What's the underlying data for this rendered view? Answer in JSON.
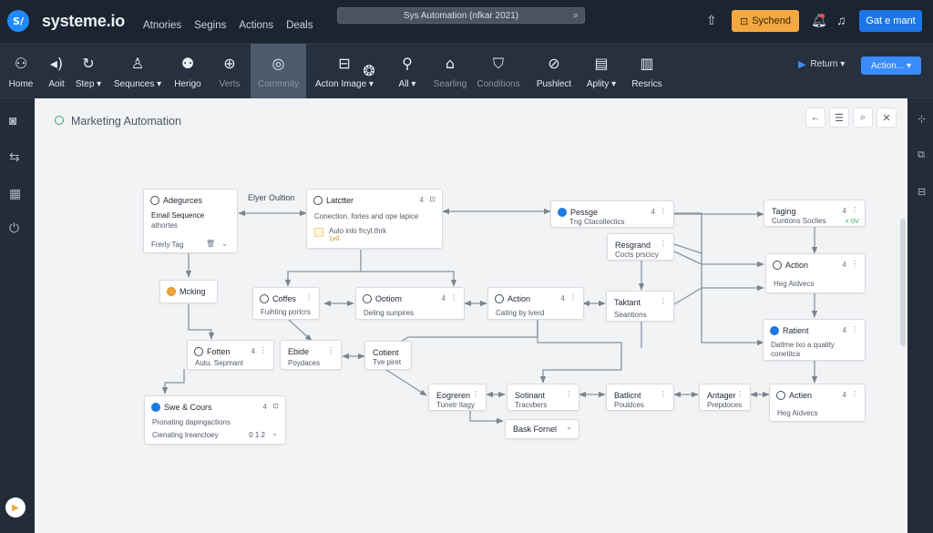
{
  "app": {
    "logo_badge": "S/",
    "logo_text": "systeme.io",
    "nav": [
      "Atnories",
      "Segins",
      "Actions",
      "Deals"
    ],
    "search_text": "Sys Automation (nfkar 2021)",
    "btn_orange": "Sychend",
    "btn_blue": "Gat e mant"
  },
  "toolbar": {
    "items": [
      {
        "label": "Home",
        "icon": "dashboard-icon"
      },
      {
        "label": "Aoit",
        "icon": "speaker-icon"
      },
      {
        "label": "Step ▾",
        "icon": "refresh-icon"
      },
      {
        "label": "Sequnces ▾",
        "icon": "person-icon"
      },
      {
        "label": "Herigo",
        "icon": "people-icon"
      },
      {
        "label": "Verts",
        "icon": "target-icon"
      },
      {
        "label": "Commnity",
        "icon": "globe-icon"
      },
      {
        "label": "Acton Image ▾",
        "icon": "inbox-icon"
      },
      {
        "label": "All ▾",
        "icon": "globe2-icon"
      },
      {
        "label": "Searling",
        "icon": "user-add-icon"
      },
      {
        "label": "Conditions",
        "icon": "home-icon"
      },
      {
        "label": "Pushlect",
        "icon": "shield-icon"
      },
      {
        "label": "Aplity ▾",
        "icon": "clipboard-icon"
      },
      {
        "label": "Resrics",
        "icon": "bars-icon"
      }
    ],
    "return_label": "Return ▾",
    "action_label": "Action... ▾"
  },
  "canvas": {
    "title": "Marketing Automation",
    "edge_label": "Elyer Oultion"
  },
  "nodes": [
    {
      "id": "n1",
      "title": "Adegurces",
      "lines": [
        "Email Sequence",
        "athortes"
      ],
      "footer": "Frerly Tag",
      "num": "",
      "kebab": ""
    },
    {
      "id": "n2",
      "title": "Latctter",
      "lines": [
        "Conection. fories and ope lapice"
      ],
      "tag": "Aulo inlo frcyl.thrk",
      "tag2": "1x0",
      "num": "4",
      "kebab": "⊡"
    },
    {
      "id": "n3",
      "title": "Pessge",
      "lines": [
        "Tng Ctacolleclics"
      ],
      "num": "4",
      "kebab": "⋮"
    },
    {
      "id": "n4",
      "title": "Resgrand",
      "lines": [
        "Cocts prscicy"
      ],
      "num": "",
      "kebab": "⋮"
    },
    {
      "id": "n5",
      "title": "Taging",
      "lines": [
        "Cuntions Soclies"
      ],
      "tag": "× 0V",
      "num": "4",
      "kebab": "⋮"
    },
    {
      "id": "n6",
      "title": "Mcking",
      "lines": [],
      "num": "",
      "kebab": ""
    },
    {
      "id": "n7",
      "title": "Coffes",
      "lines": [
        "Fuihting porlcrs"
      ],
      "num": "",
      "kebab": "⋮"
    },
    {
      "id": "n8",
      "title": "Ootiom",
      "lines": [
        "Deling sunpires"
      ],
      "num": "4",
      "kebab": "⋮"
    },
    {
      "id": "n9",
      "title": "Action",
      "lines": [
        "Cating by lverd"
      ],
      "num": "4",
      "kebab": "⋮"
    },
    {
      "id": "n10",
      "title": "Taktant",
      "lines": [
        "Seantions"
      ],
      "num": "",
      "kebab": "⋮"
    },
    {
      "id": "n11",
      "title": "Action",
      "lines": [
        "Heg Aidvecs"
      ],
      "num": "4",
      "kebab": "⋮"
    },
    {
      "id": "n12",
      "title": "Fotten",
      "lines": [
        "Autu. Sepmant"
      ],
      "num": "4",
      "kebab": "⋮"
    },
    {
      "id": "n13",
      "title": "Ebide",
      "lines": [
        "Poydaces"
      ],
      "num": "",
      "kebab": "⋮"
    },
    {
      "id": "n14",
      "title": "Cotient",
      "lines": [
        "Tve piret"
      ],
      "num": "",
      "kebab": ""
    },
    {
      "id": "n15",
      "title": "Ratient",
      "lines": [
        "Datlme lxo a quality",
        "conetitca"
      ],
      "num": "4",
      "kebab": "⋮"
    },
    {
      "id": "n16",
      "title": "Swe & Cours",
      "lines": [
        "Pronating dapingactions",
        "Cienating lreancloey"
      ],
      "footer_num": "0 1 2",
      "num": "4",
      "kebab": "⊡"
    },
    {
      "id": "n17",
      "title": "Eogreren",
      "lines": [
        "Tunetr ltagy"
      ],
      "num": "",
      "kebab": "⋮"
    },
    {
      "id": "n18",
      "title": "Sotinant",
      "lines": [
        "Tracvbers"
      ],
      "num": "",
      "kebab": "⋮"
    },
    {
      "id": "n19",
      "title": "Batlicnt",
      "lines": [
        "Pouldces"
      ],
      "num": "",
      "kebab": "⋮"
    },
    {
      "id": "n20",
      "title": "Antager",
      "lines": [
        "Prepdoces"
      ],
      "num": "",
      "kebab": "⋮"
    },
    {
      "id": "n21",
      "title": "Actien",
      "lines": [
        "Heg Aidvecs"
      ],
      "num": "4",
      "kebab": "⋮"
    },
    {
      "id": "n22",
      "title": "Bask Fornel",
      "lines": [],
      "num": "",
      "kebab": "⌄"
    }
  ]
}
